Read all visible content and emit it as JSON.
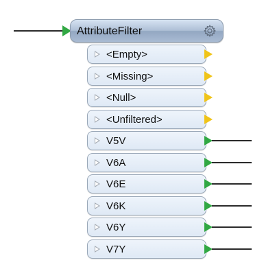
{
  "transformer": {
    "title": "AttributeFilter",
    "gear_icon": "gear-icon"
  },
  "ports": [
    {
      "label": "<Empty>",
      "connected": false,
      "port_color": "#f0c419"
    },
    {
      "label": "<Missing>",
      "connected": false,
      "port_color": "#f0c419"
    },
    {
      "label": "<Null>",
      "connected": false,
      "port_color": "#f0c419"
    },
    {
      "label": "<Unfiltered>",
      "connected": false,
      "port_color": "#f0c419"
    },
    {
      "label": "V5V",
      "connected": true,
      "port_color": "#31a843"
    },
    {
      "label": "V6A",
      "connected": true,
      "port_color": "#31a843"
    },
    {
      "label": "V6E",
      "connected": true,
      "port_color": "#31a843"
    },
    {
      "label": "V6K",
      "connected": true,
      "port_color": "#31a843"
    },
    {
      "label": "V6Y",
      "connected": true,
      "port_color": "#31a843"
    },
    {
      "label": "V7Y",
      "connected": true,
      "port_color": "#31a843"
    }
  ],
  "colors": {
    "input_port": "#31a843",
    "header_gradient_top": "#d6e3f2",
    "header_gradient_bottom": "#93a7c2",
    "row_fill": "#e6eef8"
  }
}
